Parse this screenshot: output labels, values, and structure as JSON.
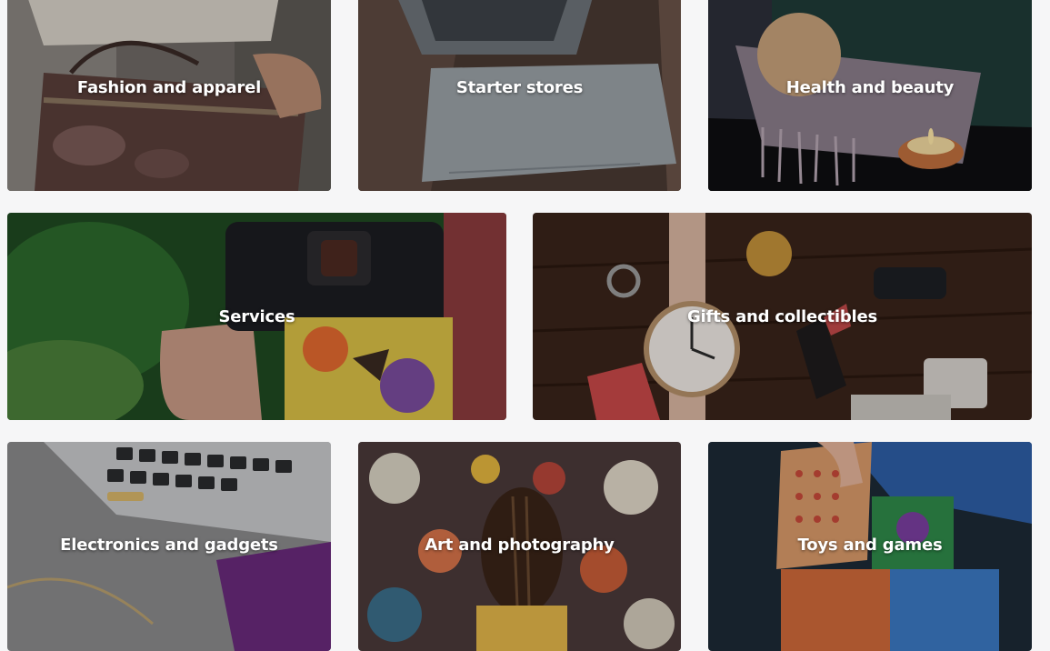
{
  "categories": [
    {
      "label": "Fashion and apparel",
      "image": "handbag-photo"
    },
    {
      "label": "Starter stores",
      "image": "laptop-desk-photo"
    },
    {
      "label": "Health and beauty",
      "image": "candle-towel-photo"
    },
    {
      "label": "Services",
      "image": "camera-butterfly-photo"
    },
    {
      "label": "Gifts and collectibles",
      "image": "watch-lipstick-photo"
    },
    {
      "label": "Electronics and gadgets",
      "image": "keyboard-phone-photo"
    },
    {
      "label": "Art and photography",
      "image": "floral-painting-photo"
    },
    {
      "label": "Toys and games",
      "image": "toy-blocks-photo"
    }
  ],
  "colors": {
    "page_background": "#f6f6f7",
    "label_text": "#ffffff"
  }
}
